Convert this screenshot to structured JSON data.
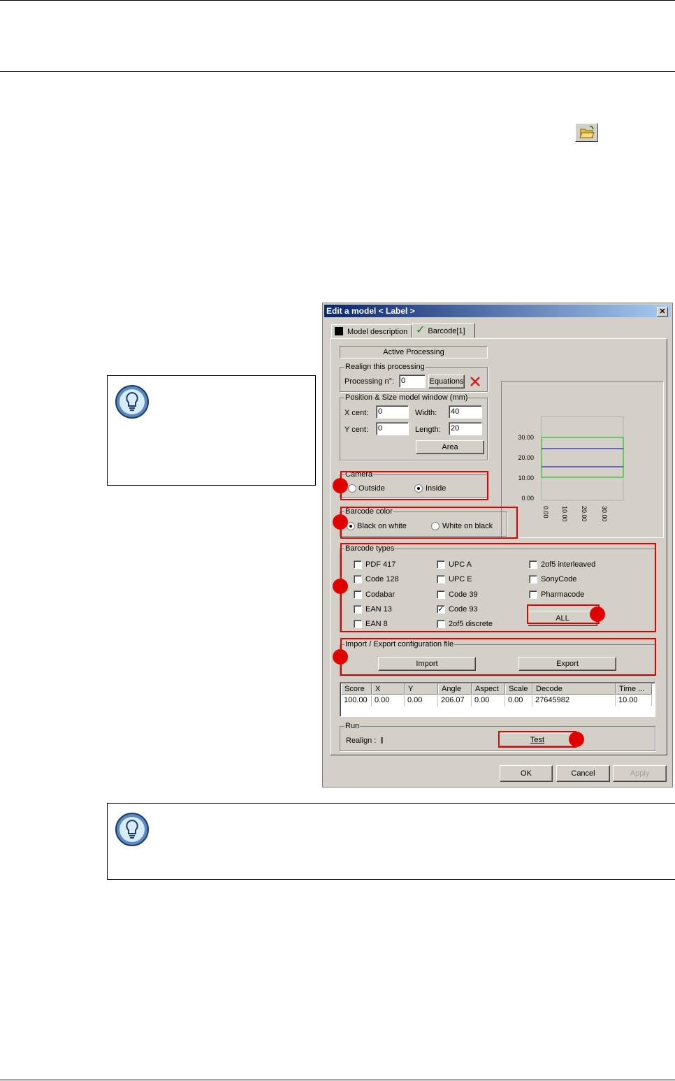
{
  "dialog": {
    "title": "Edit a model < Label >",
    "close_symbol": "✕",
    "tabs": [
      {
        "label": "Model description"
      },
      {
        "label": "Barcode[1]"
      }
    ],
    "active_processing": "Active Processing",
    "realign": {
      "group_label": "Realign this processing",
      "processing_label": "Processing n°:",
      "processing_value": "0",
      "equations_button": "Equations"
    },
    "position": {
      "group_label": "Position & Size model window (mm)",
      "xcent_label": "X cent:",
      "xcent_value": "0",
      "width_label": "Width:",
      "width_value": "40",
      "ycent_label": "Y cent:",
      "ycent_value": "0",
      "length_label": "Length:",
      "length_value": "20",
      "area_button": "Area"
    },
    "camera": {
      "group_label": "Camera",
      "outside": "Outside",
      "inside": "Inside",
      "selected": "Inside"
    },
    "barcode_color": {
      "group_label": "Barcode color",
      "black_on_white": "Black on white",
      "white_on_black": "White on black",
      "selected": "Black on white"
    },
    "barcode_types": {
      "group_label": "Barcode types",
      "col1": [
        "PDF 417",
        "Code 128",
        "Codabar",
        "EAN 13",
        "EAN 8"
      ],
      "col2": [
        "UPC A",
        "UPC E",
        "Code 39",
        "Code 93",
        "2of5 discrete"
      ],
      "col3": [
        "2of5 interleaved",
        "SonyCode",
        "Pharmacode"
      ],
      "checked": [
        "Code 93"
      ],
      "all_button": "ALL"
    },
    "import_export": {
      "group_label": "Import / Export configuration file",
      "import_button": "Import",
      "export_button": "Export"
    },
    "results": {
      "headers": [
        "Score",
        "X",
        "Y",
        "Angle",
        "Aspect",
        "Scale",
        "Decode",
        "Time ..."
      ],
      "row": [
        "100.00",
        "0.00",
        "0.00",
        "206.07",
        "0.00",
        "0.00",
        "27645982",
        "10.00"
      ]
    },
    "run": {
      "group_label": "Run",
      "realign_label": "Realign :",
      "test_button": "Test"
    },
    "footer": {
      "ok": "OK",
      "cancel": "Cancel",
      "apply": "Apply"
    },
    "preview": {
      "y_ticks": [
        "30.00",
        "20.00",
        "10.00",
        "0.00"
      ],
      "x_ticks": [
        "0.00",
        "10.00",
        "20.00",
        "30.00"
      ]
    }
  },
  "colors": {
    "highlight_red": "#e00000",
    "title_blue": "#0a246a",
    "chart_green": "#00c000",
    "chart_blue": "#0000c0"
  }
}
